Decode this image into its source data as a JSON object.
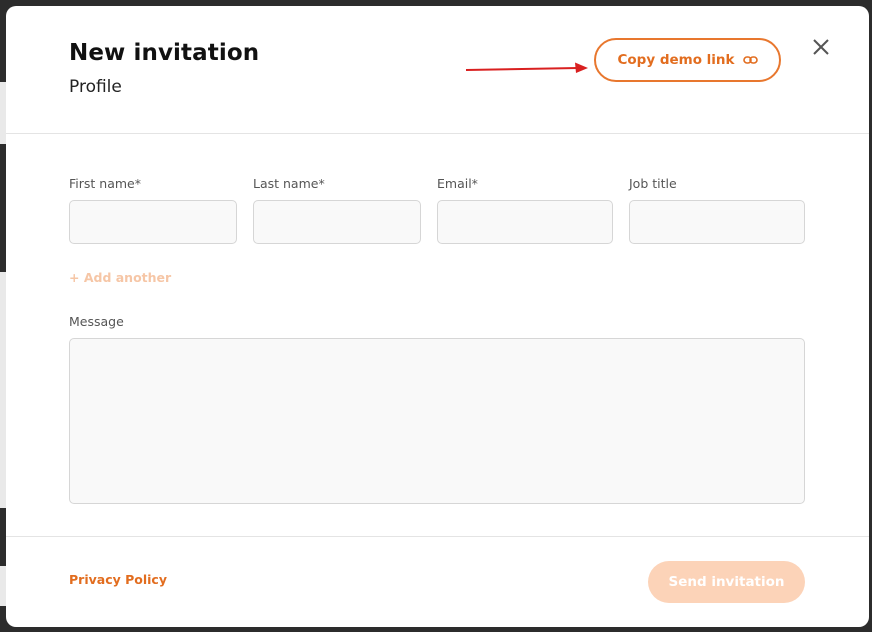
{
  "dialog": {
    "title": "New invitation",
    "subtitle": "Profile",
    "copy_demo_link_label": "Copy demo link"
  },
  "form": {
    "fields": [
      {
        "label": "First name*",
        "value": "",
        "placeholder": ""
      },
      {
        "label": "Last name*",
        "value": "",
        "placeholder": ""
      },
      {
        "label": "Email*",
        "value": "",
        "placeholder": ""
      },
      {
        "label": "Job title",
        "value": "",
        "placeholder": ""
      }
    ],
    "add_another_label": "+ Add another",
    "message_label": "Message",
    "message_value": ""
  },
  "footer": {
    "privacy_label": "Privacy Policy",
    "send_label": "Send invitation"
  },
  "colors": {
    "accent": "#e26d1f",
    "accent_disabled": "#fcd3b8",
    "annotation_arrow": "#d92020"
  },
  "icons": {
    "copy_button_icon": "link-icon",
    "close": "close-icon",
    "annotation": "arrow-icon"
  }
}
